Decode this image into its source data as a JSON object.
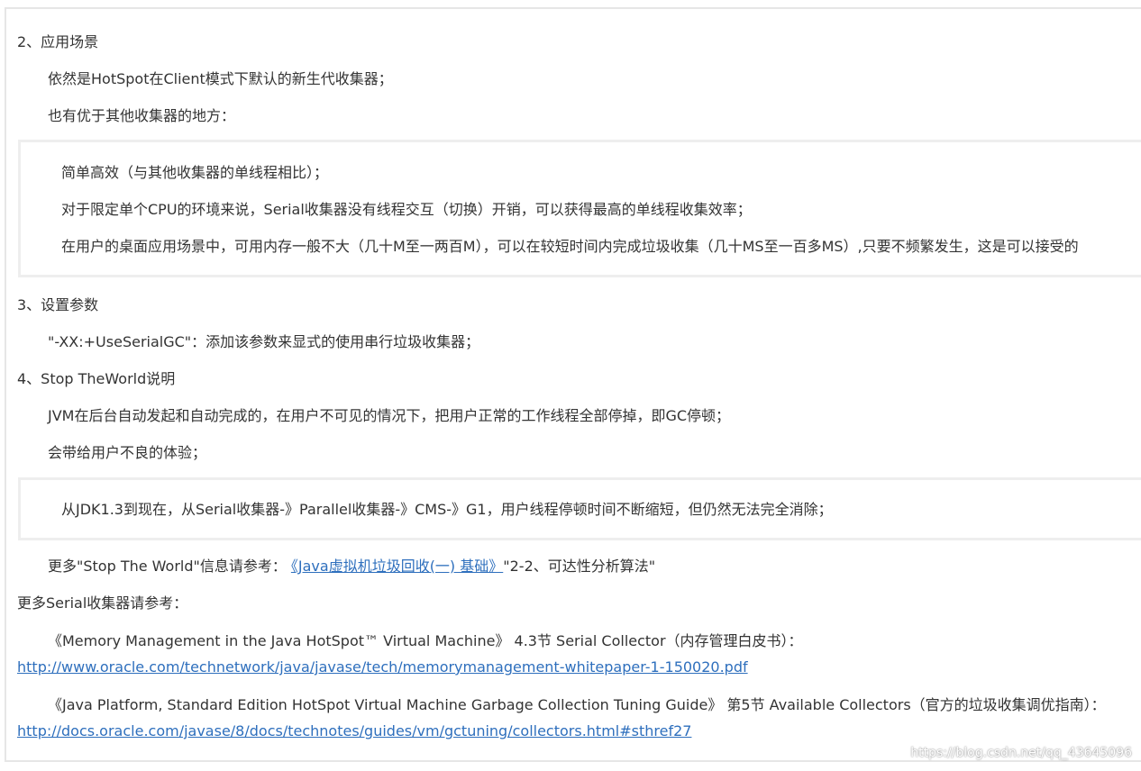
{
  "theme": {
    "text": "#333333",
    "link": "#2e6fbd",
    "frame_border": "#e6e6e6",
    "quote_border": "#eeeeee",
    "background": "#ffffff"
  },
  "usage": {
    "heading": "2、应用场景",
    "paragraphs": [
      "依然是HotSpot在Client模式下默认的新生代收集器；",
      "也有优于其他收集器的地方："
    ],
    "quote": [
      "简单高效（与其他收集器的单线程相比）；",
      "对于限定单个CPU的环境来说，Serial收集器没有线程交互（切换）开销，可以获得最高的单线程收集效率；",
      "在用户的桌面应用场景中，可用内存一般不大（几十M至一两百M），可以在较短时间内完成垃圾收集（几十MS至一百多MS）,只要不频繁发生，这是可以接受的"
    ]
  },
  "parameters": {
    "heading": "3、设置参数",
    "paragraphs": [
      "\"-XX:+UseSerialGC\"：添加该参数来显式的使用串行垃圾收集器；"
    ]
  },
  "stop_the_world": {
    "heading": "4、Stop TheWorld说明",
    "paragraphs": [
      "JVM在后台自动发起和自动完成的，在用户不可见的情况下，把用户正常的工作线程全部停掉，即GC停顿；",
      "会带给用户不良的体验；"
    ],
    "quote": [
      "从JDK1.3到现在，从Serial收集器-》Parallel收集器-》CMS-》G1，用户线程停顿时间不断缩短，但仍然无法完全消除；"
    ],
    "more": {
      "prefix": "更多\"Stop The World\"信息请参考：",
      "link_text": "《Java虚拟机垃圾回收(一) 基础》",
      "suffix": "\"2-2、可达性分析算法\""
    }
  },
  "references": {
    "heading": "更多Serial收集器请参考：",
    "items": [
      {
        "title": "《Memory Management in the Java HotSpot™ Virtual Machine》 4.3节 Serial Collector（内存管理白皮书）：",
        "url": "http://www.oracle.com/technetwork/java/javase/tech/memorymanagement-whitepaper-1-150020.pdf"
      },
      {
        "title": "《Java Platform, Standard Edition HotSpot Virtual Machine Garbage Collection Tuning Guide》 第5节 Available Collectors（官方的垃圾收集调优指南）：",
        "url": "http://docs.oracle.com/javase/8/docs/technotes/guides/vm/gctuning/collectors.html#sthref27"
      }
    ]
  },
  "page": {
    "watermark": "https://blog.csdn.net/qq_43645096"
  }
}
